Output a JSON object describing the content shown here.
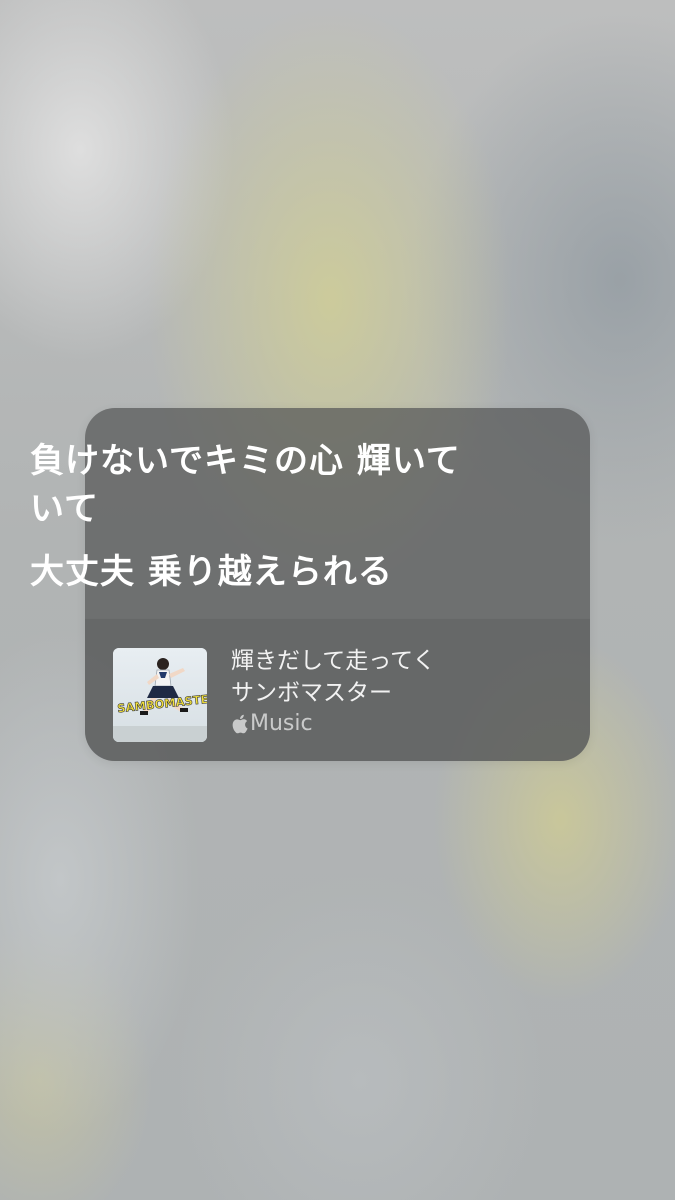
{
  "lyrics": {
    "line1": "負けないでキミの心 輝いていて",
    "line2": "大丈夫 乗り越えられる"
  },
  "track": {
    "title": "輝きだして走ってく",
    "artist": "サンボマスター",
    "artwork_text": "SAMBOMASTER",
    "source_label": "Music",
    "source_icon": "apple-logo-icon"
  },
  "colors": {
    "card_background": "#545656",
    "lyric_text": "#ffffff",
    "artwork_logo_yellow": "#f2e13a"
  }
}
